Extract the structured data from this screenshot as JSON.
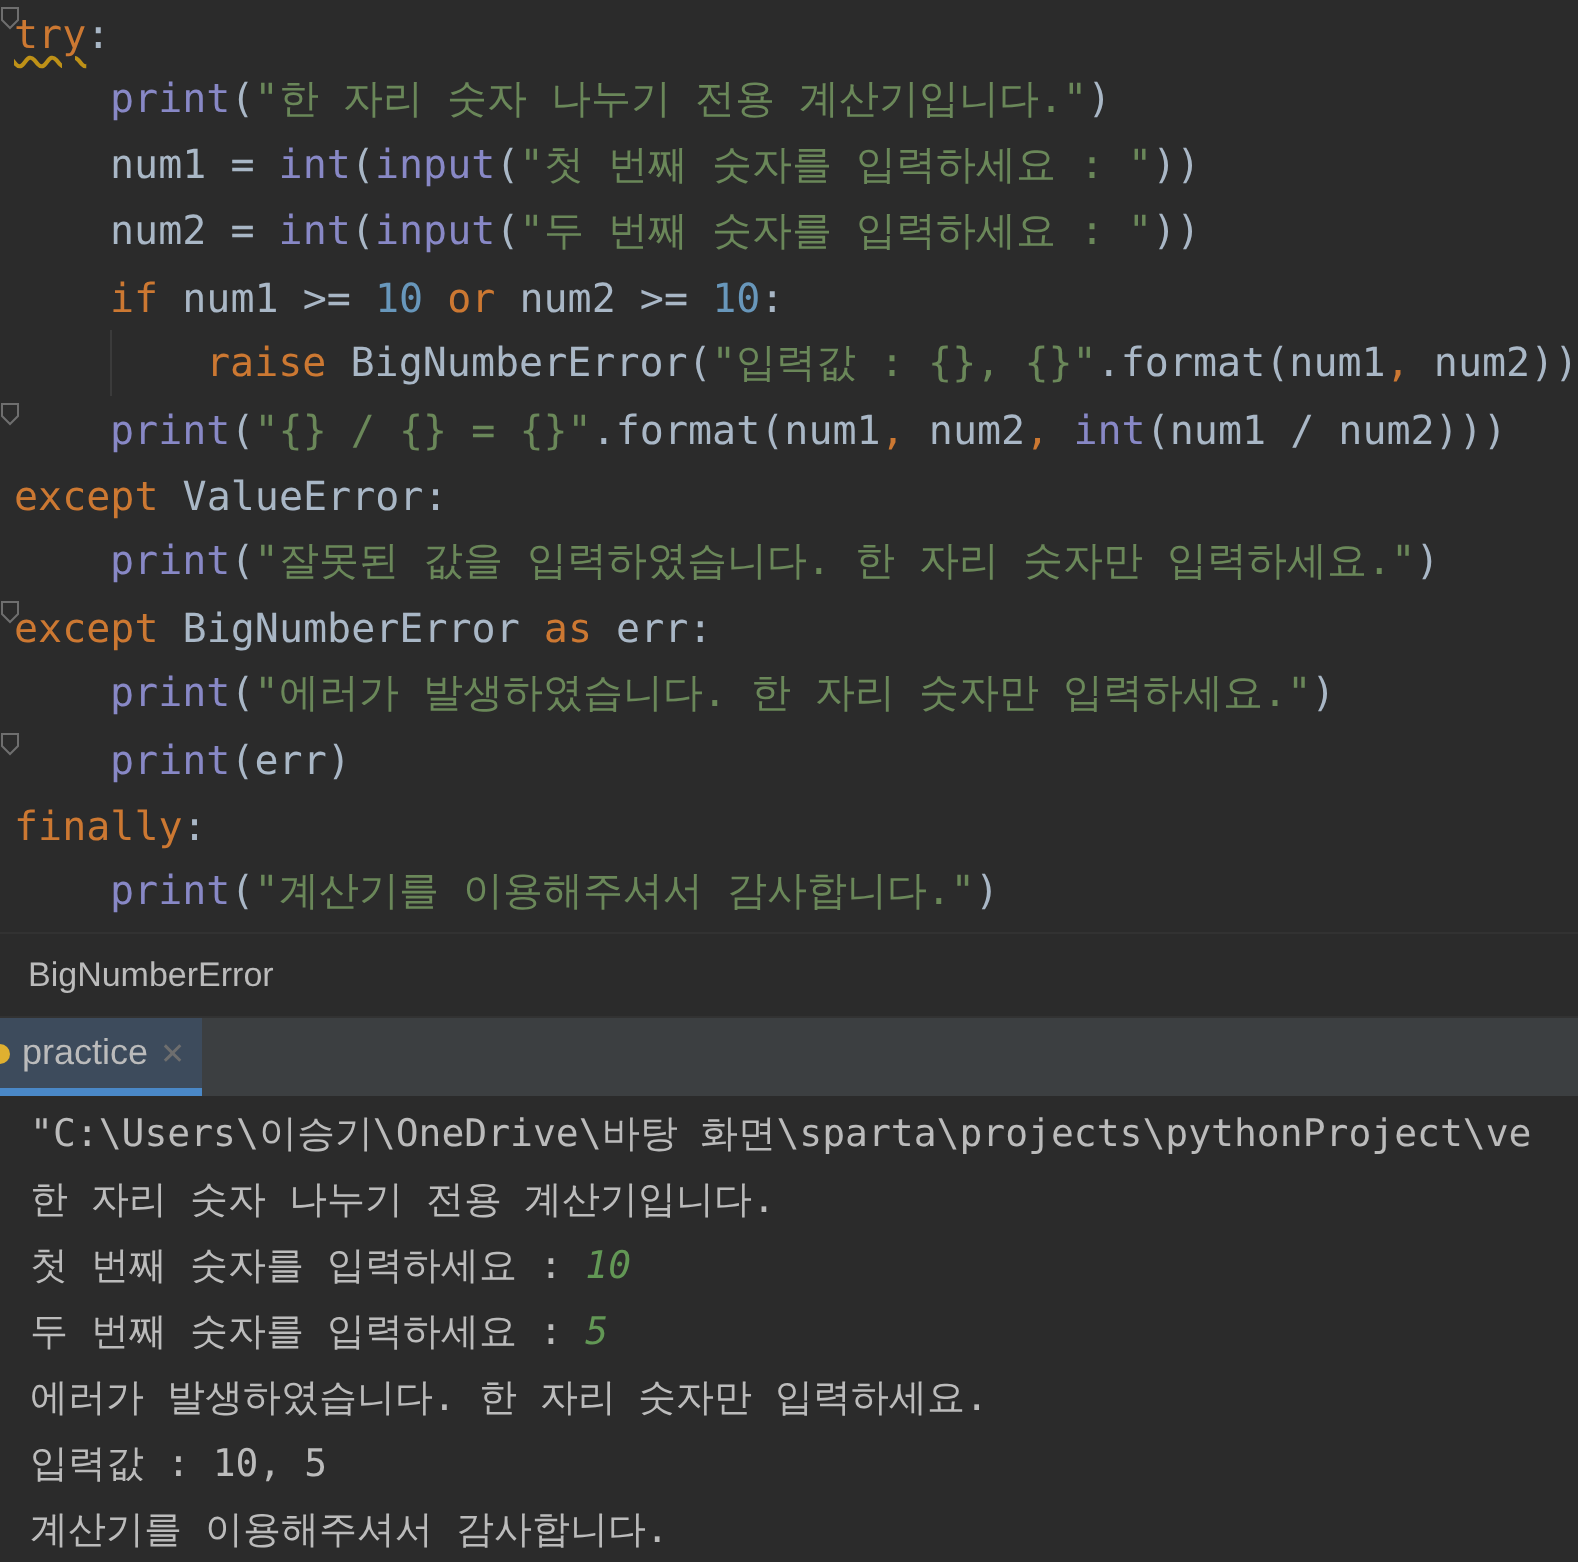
{
  "editor": {
    "lines": [
      {
        "fold_marker": true,
        "tokens": [
          {
            "t": "try",
            "kind": "keyword",
            "warn": true
          },
          {
            "t": ":",
            "kind": "plain"
          }
        ],
        "children": [
          {
            "tokens": [
              {
                "t": "print",
                "kind": "builtin"
              },
              {
                "t": "(",
                "kind": "plain"
              },
              {
                "t": "\"한 자리 숫자 나누기 전용 계산기입니다.\"",
                "kind": "string"
              },
              {
                "t": ")",
                "kind": "plain"
              }
            ]
          },
          {
            "tokens": [
              {
                "t": "num1 = ",
                "kind": "plain"
              },
              {
                "t": "int",
                "kind": "builtin"
              },
              {
                "t": "(",
                "kind": "plain"
              },
              {
                "t": "input",
                "kind": "builtin"
              },
              {
                "t": "(",
                "kind": "plain"
              },
              {
                "t": "\"첫 번째 숫자를 입력하세요 : \"",
                "kind": "string"
              },
              {
                "t": "))",
                "kind": "plain"
              }
            ]
          },
          {
            "tokens": [
              {
                "t": "num2 = ",
                "kind": "plain"
              },
              {
                "t": "int",
                "kind": "builtin"
              },
              {
                "t": "(",
                "kind": "plain"
              },
              {
                "t": "input",
                "kind": "builtin"
              },
              {
                "t": "(",
                "kind": "plain"
              },
              {
                "t": "\"두 번째 숫자를 입력하세요 : \"",
                "kind": "string"
              },
              {
                "t": "))",
                "kind": "plain"
              }
            ]
          },
          {
            "tokens": [
              {
                "t": "if",
                "kind": "keyword"
              },
              {
                "t": " num1 >= ",
                "kind": "plain"
              },
              {
                "t": "10",
                "kind": "number"
              },
              {
                "t": " or",
                "kind": "keyword"
              },
              {
                "t": " num2 >= ",
                "kind": "plain"
              },
              {
                "t": "10",
                "kind": "number"
              },
              {
                "t": ":",
                "kind": "plain"
              }
            ],
            "children": [
              {
                "tokens": [
                  {
                    "t": "raise",
                    "kind": "keyword"
                  },
                  {
                    "t": " BigNumberError(",
                    "kind": "plain"
                  },
                  {
                    "t": "\"입력값 : {}, {}\"",
                    "kind": "string"
                  },
                  {
                    "t": ".format(num1",
                    "kind": "plain"
                  },
                  {
                    "t": ",",
                    "kind": "keyword"
                  },
                  {
                    "t": " num2))",
                    "kind": "plain"
                  }
                ]
              }
            ]
          },
          {
            "fold_marker": true,
            "tokens": [
              {
                "t": "print",
                "kind": "builtin"
              },
              {
                "t": "(",
                "kind": "plain"
              },
              {
                "t": "\"{} / {} = {}\"",
                "kind": "string"
              },
              {
                "t": ".format(num1",
                "kind": "plain"
              },
              {
                "t": ",",
                "kind": "keyword"
              },
              {
                "t": " num2",
                "kind": "plain"
              },
              {
                "t": ", ",
                "kind": "keyword"
              },
              {
                "t": "int",
                "kind": "builtin"
              },
              {
                "t": "(num1 / num2)))",
                "kind": "plain"
              }
            ]
          }
        ]
      },
      {
        "tokens": [
          {
            "t": "except",
            "kind": "keyword"
          },
          {
            "t": " ValueError:",
            "kind": "plain"
          }
        ],
        "children": [
          {
            "tokens": [
              {
                "t": "print",
                "kind": "builtin"
              },
              {
                "t": "(",
                "kind": "plain"
              },
              {
                "t": "\"잘못된 값을 입력하였습니다. 한 자리 숫자만 입력하세요.\"",
                "kind": "string"
              },
              {
                "t": ")",
                "kind": "plain"
              }
            ]
          }
        ]
      },
      {
        "fold_marker": true,
        "tokens": [
          {
            "t": "except",
            "kind": "keyword"
          },
          {
            "t": " BigNumberError ",
            "kind": "plain"
          },
          {
            "t": "as",
            "kind": "keyword"
          },
          {
            "t": " err:",
            "kind": "plain"
          }
        ],
        "children": [
          {
            "tokens": [
              {
                "t": "print",
                "kind": "builtin"
              },
              {
                "t": "(",
                "kind": "plain"
              },
              {
                "t": "\"에러가 발생하였습니다. 한 자리 숫자만 입력하세요.\"",
                "kind": "string"
              },
              {
                "t": ")",
                "kind": "plain"
              }
            ]
          },
          {
            "fold_marker": true,
            "tokens": [
              {
                "t": "print",
                "kind": "builtin"
              },
              {
                "t": "(err)",
                "kind": "plain"
              }
            ]
          }
        ]
      },
      {
        "tokens": [
          {
            "t": "finally",
            "kind": "keyword"
          },
          {
            "t": ":",
            "kind": "plain"
          }
        ],
        "children": [
          {
            "tokens": [
              {
                "t": "print",
                "kind": "builtin"
              },
              {
                "t": "(",
                "kind": "plain"
              },
              {
                "t": "\"계산기를 이용해주셔서 감사합니다.\"",
                "kind": "string"
              },
              {
                "t": ")",
                "kind": "plain"
              }
            ]
          }
        ]
      }
    ]
  },
  "breadcrumb": "BigNumberError",
  "run_tabs": [
    {
      "label": "practice",
      "close": "✕",
      "selected": true
    }
  ],
  "console": [
    {
      "text": "\"C:\\Users\\이승기\\OneDrive\\바탕 화면\\sparta\\projects\\pythonProject\\ve"
    },
    {
      "text": "한 자리 숫자 나누기 전용 계산기입니다."
    },
    {
      "text": "첫 번째 숫자를 입력하세요 : ",
      "input": "10"
    },
    {
      "text": "두 번째 숫자를 입력하세요 : ",
      "input": "5"
    },
    {
      "text": "에러가 발생하였습니다. 한 자리 숫자만 입력하세요."
    },
    {
      "text": "입력값 : 10, 5"
    },
    {
      "text": "계산기를 이용해주셔서 감사합니다."
    }
  ]
}
